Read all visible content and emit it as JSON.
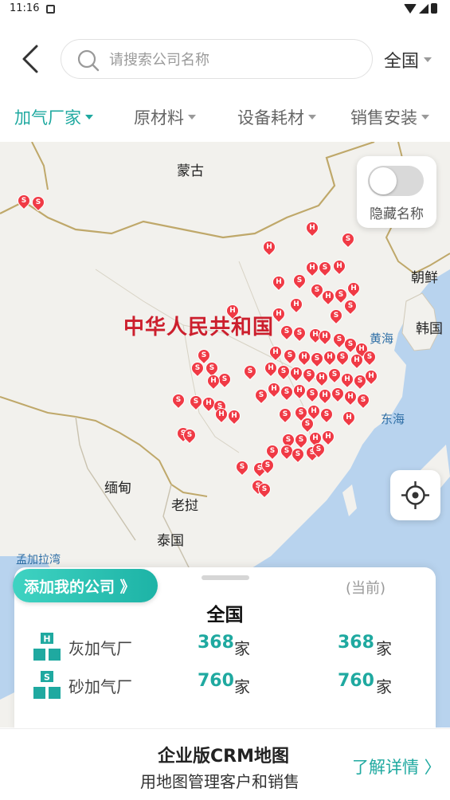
{
  "status_bar": {
    "time": "11:16"
  },
  "search": {
    "placeholder": "请搜索公司名称",
    "value": ""
  },
  "region_select": {
    "label": "全国"
  },
  "tabs": [
    {
      "label": "加气厂家",
      "active": true
    },
    {
      "label": "原材料",
      "active": false
    },
    {
      "label": "设备耗材",
      "active": false
    },
    {
      "label": "销售安装",
      "active": false
    }
  ],
  "map": {
    "labels": {
      "mongolia": "蒙古",
      "china": "中华人民共和国",
      "north_korea": "朝鲜",
      "south_korea": "韩国",
      "yellow_sea": "黄海",
      "east_sea": "东海",
      "myanmar": "缅甸",
      "laos": "老挝",
      "thailand": "泰国",
      "bay_of_bengal": "孟加拉湾"
    },
    "toggle_label": "隐藏名称",
    "toggle_on": false
  },
  "stats": {
    "add_company_label": "添加我的公司 》",
    "current_label": "(当前)",
    "region_title": "全国",
    "rows": [
      {
        "icon_letter": "H",
        "name": "灰加气厂",
        "count": "368",
        "unit": "家",
        "current_count": "368",
        "current_unit": "家"
      },
      {
        "icon_letter": "S",
        "name": "砂加气厂",
        "count": "760",
        "unit": "家",
        "current_count": "760",
        "current_unit": "家"
      }
    ]
  },
  "banner": {
    "title": "企业版CRM地图",
    "subtitle": "用地图管理客户和销售",
    "link_label": "了解详情 〉"
  },
  "colors": {
    "accent": "#1fa9a0",
    "pin": "#f03a45",
    "country_label": "#cc1f2d"
  }
}
